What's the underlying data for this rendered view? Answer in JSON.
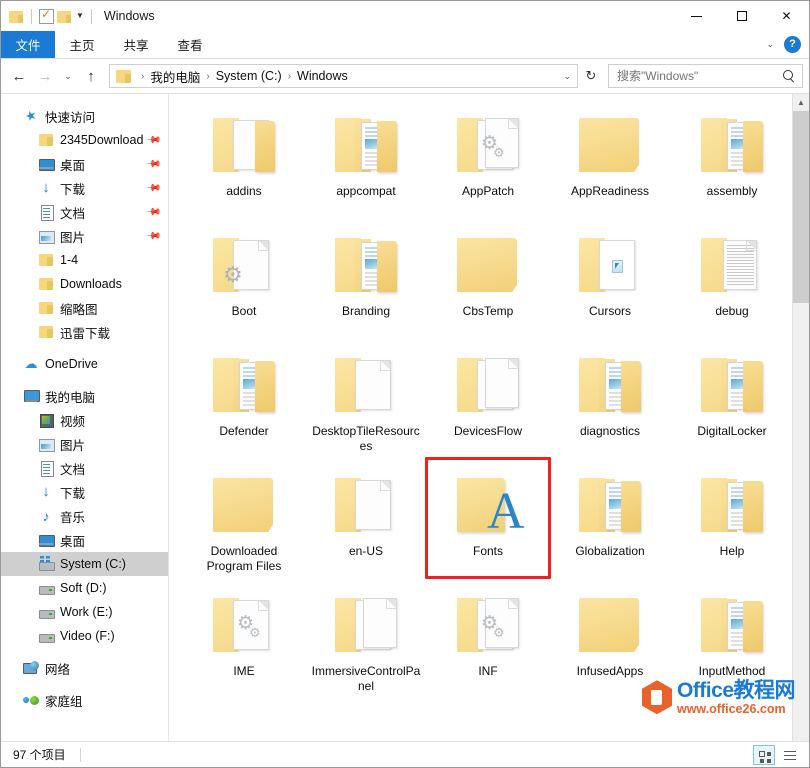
{
  "window": {
    "title": "Windows",
    "quick_access": [
      "folder-icon",
      "checklist-icon",
      "folder-icon"
    ],
    "controls": {
      "minimize": "—",
      "maximize": "□",
      "close": "✕"
    }
  },
  "ribbon": {
    "tabs": [
      {
        "label": "文件",
        "active": true
      },
      {
        "label": "主页",
        "active": false
      },
      {
        "label": "共享",
        "active": false
      },
      {
        "label": "查看",
        "active": false
      }
    ],
    "collapse_label": "⌄",
    "help_label": "?"
  },
  "addressbar": {
    "back": "←",
    "forward": "→",
    "recent": "⌄",
    "up": "↑",
    "breadcrumb": [
      "我的电脑",
      "System (C:)",
      "Windows"
    ],
    "separator": "›",
    "dropdown": "⌄",
    "refresh": "↻"
  },
  "search": {
    "placeholder": "搜索\"Windows\"",
    "value": ""
  },
  "sidebar": {
    "groups": [
      {
        "name": "快速访问",
        "icon": "star-pin-icon",
        "items": [
          {
            "label": "2345Download",
            "icon": "folder-icon",
            "pinned": true
          },
          {
            "label": "桌面",
            "icon": "desktop-icon",
            "pinned": true
          },
          {
            "label": "下载",
            "icon": "download-icon",
            "pinned": true
          },
          {
            "label": "文档",
            "icon": "document-icon",
            "pinned": true
          },
          {
            "label": "图片",
            "icon": "pictures-icon",
            "pinned": true
          },
          {
            "label": "1-4",
            "icon": "folder-icon",
            "pinned": false
          },
          {
            "label": "Downloads",
            "icon": "folder-icon",
            "pinned": false
          },
          {
            "label": "缩略图",
            "icon": "folder-icon",
            "pinned": false
          },
          {
            "label": "迅雷下载",
            "icon": "folder-icon",
            "pinned": false
          }
        ]
      },
      {
        "name": "OneDrive",
        "icon": "cloud-icon",
        "items": []
      },
      {
        "name": "我的电脑",
        "icon": "computer-icon",
        "items": [
          {
            "label": "视频",
            "icon": "video-icon",
            "pinned": false
          },
          {
            "label": "图片",
            "icon": "pictures-icon",
            "pinned": false
          },
          {
            "label": "文档",
            "icon": "document-icon",
            "pinned": false
          },
          {
            "label": "下载",
            "icon": "download-icon",
            "pinned": false
          },
          {
            "label": "音乐",
            "icon": "music-icon",
            "pinned": false
          },
          {
            "label": "桌面",
            "icon": "desktop-icon",
            "pinned": false
          },
          {
            "label": "System (C:)",
            "icon": "system-drive-icon",
            "pinned": false,
            "selected": true
          },
          {
            "label": "Soft (D:)",
            "icon": "drive-icon",
            "pinned": false
          },
          {
            "label": "Work (E:)",
            "icon": "drive-icon",
            "pinned": false
          },
          {
            "label": "Video (F:)",
            "icon": "drive-icon",
            "pinned": false
          }
        ]
      },
      {
        "name": "网络",
        "icon": "network-icon",
        "items": []
      },
      {
        "name": "家庭组",
        "icon": "homegroup-icon",
        "items": []
      }
    ]
  },
  "content": {
    "items": [
      {
        "label": "addins",
        "style": "sheet"
      },
      {
        "label": "appcompat",
        "style": "thumbs"
      },
      {
        "label": "AppPatch",
        "style": "gears2"
      },
      {
        "label": "AppReadiness",
        "style": "plain"
      },
      {
        "label": "assembly",
        "style": "thumbs"
      },
      {
        "label": "Boot",
        "style": "sheet-gear"
      },
      {
        "label": "Branding",
        "style": "thumbs"
      },
      {
        "label": "CbsTemp",
        "style": "plain"
      },
      {
        "label": "Cursors",
        "style": "cursors"
      },
      {
        "label": "debug",
        "style": "textpage"
      },
      {
        "label": "Defender",
        "style": "thumbs"
      },
      {
        "label": "DesktopTileResources",
        "style": "sheet"
      },
      {
        "label": "DevicesFlow",
        "style": "sheet2"
      },
      {
        "label": "diagnostics",
        "style": "thumbs"
      },
      {
        "label": "DigitalLocker",
        "style": "thumbs"
      },
      {
        "label": "Downloaded Program Files",
        "style": "plain"
      },
      {
        "label": "en-US",
        "style": "sheet"
      },
      {
        "label": "Fonts",
        "style": "fonts",
        "highlighted": true
      },
      {
        "label": "Globalization",
        "style": "thumbs"
      },
      {
        "label": "Help",
        "style": "thumbs"
      },
      {
        "label": "IME",
        "style": "gears2"
      },
      {
        "label": "ImmersiveControlPanel",
        "style": "sheet2"
      },
      {
        "label": "INF",
        "style": "gears2"
      },
      {
        "label": "InfusedApps",
        "style": "plain"
      },
      {
        "label": "InputMethod",
        "style": "thumbs"
      }
    ],
    "highlight_color": "#ee2222"
  },
  "statusbar": {
    "item_count": "97 个项目",
    "view_tiles": "tiles-view-icon",
    "view_list": "list-view-icon"
  },
  "watermark": {
    "title": "Office教程网",
    "url": "www.office26.com"
  }
}
